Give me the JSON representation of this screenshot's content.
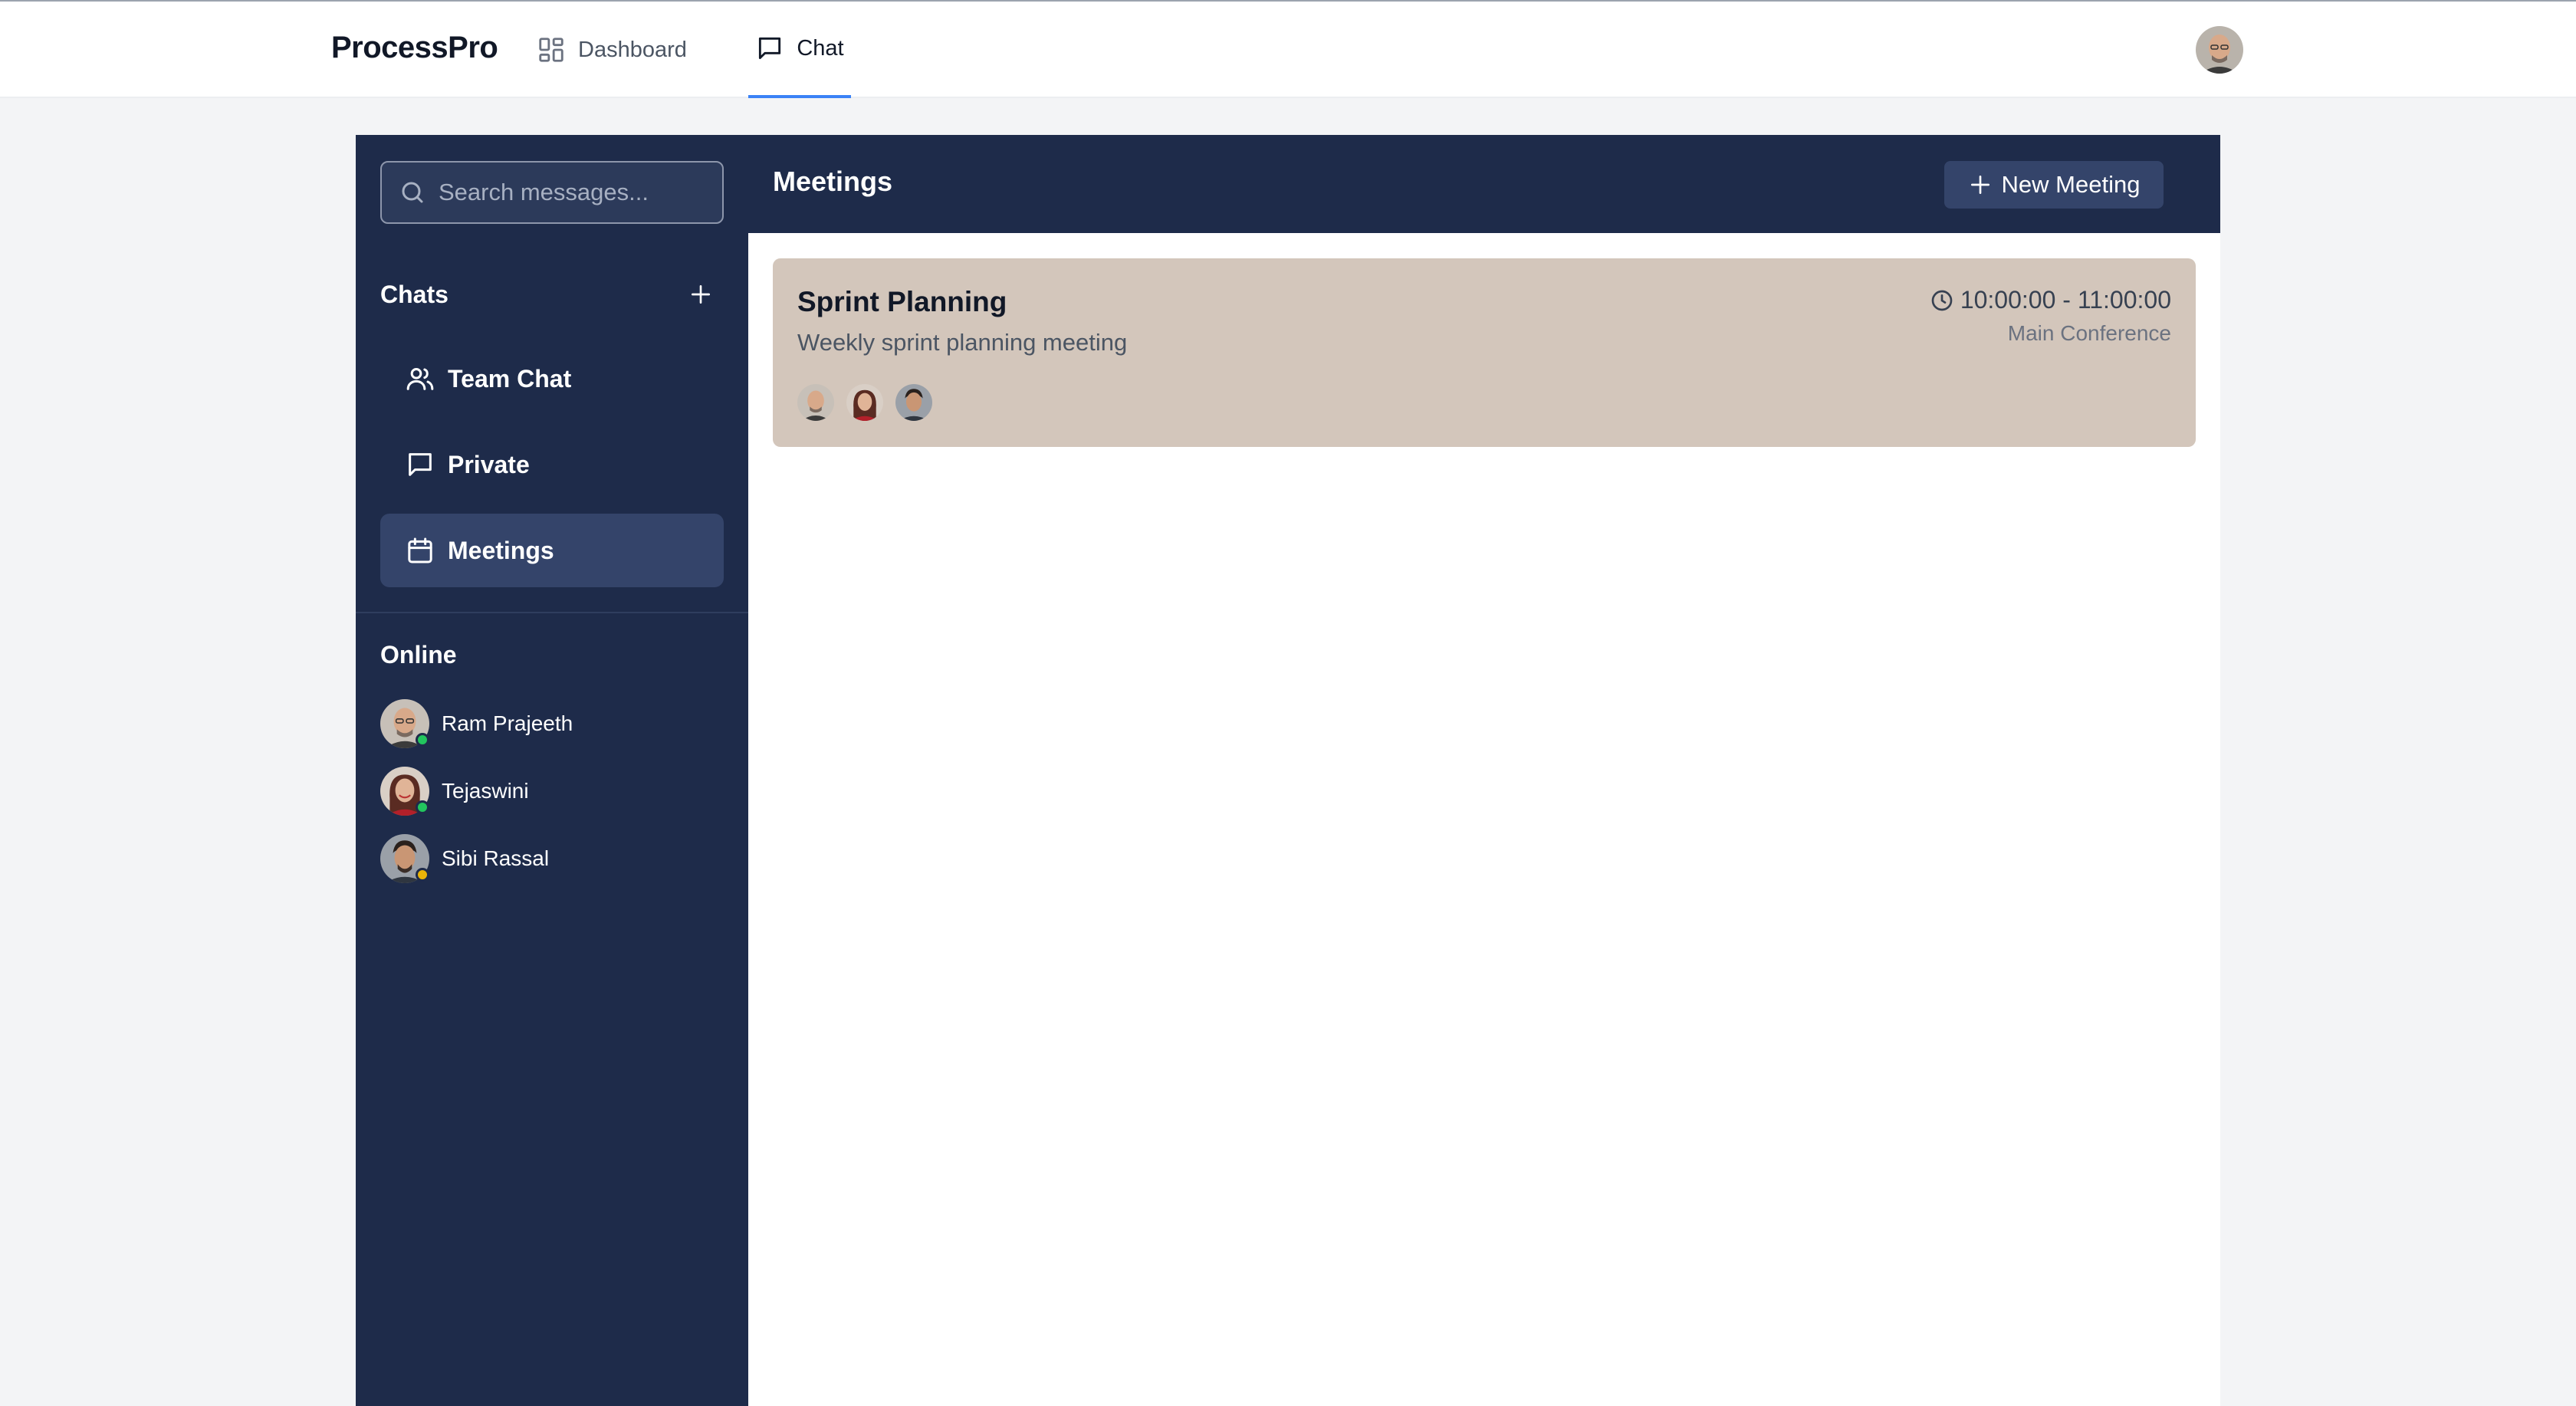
{
  "app": {
    "brand": "ProcessPro"
  },
  "nav": {
    "tabs": [
      {
        "label": "Dashboard",
        "icon": "dashboard-grid-icon"
      },
      {
        "label": "Chat",
        "icon": "chat-bubble-icon",
        "active": true
      }
    ]
  },
  "sidebar": {
    "search": {
      "placeholder": "Search messages...",
      "value": ""
    },
    "chats_title": "Chats",
    "channels": [
      {
        "label": "Team Chat",
        "icon": "users-icon"
      },
      {
        "label": "Private",
        "icon": "message-square-icon"
      },
      {
        "label": "Meetings",
        "icon": "calendar-icon",
        "active": true
      }
    ],
    "online_title": "Online",
    "online": [
      {
        "name": "Ram Prajeeth",
        "status": "online",
        "status_color": "#22c55e"
      },
      {
        "name": "Tejaswini",
        "status": "online",
        "status_color": "#22c55e"
      },
      {
        "name": "Sibi Rassal",
        "status": "away",
        "status_color": "#eab308"
      }
    ]
  },
  "main": {
    "title": "Meetings",
    "new_button": "New Meeting",
    "meetings": [
      {
        "title": "Sprint Planning",
        "description": "Weekly sprint planning meeting",
        "time": "10:00:00 - 11:00:00",
        "location": "Main Conference",
        "participants": [
          "Ram Prajeeth",
          "Tejaswini",
          "Sibi Rassal"
        ]
      }
    ]
  },
  "colors": {
    "sidebar_bg": "#1e2b4a",
    "active_item": "#34446a",
    "accent": "#3b82f6",
    "meeting_card": "#d3c6bb"
  }
}
